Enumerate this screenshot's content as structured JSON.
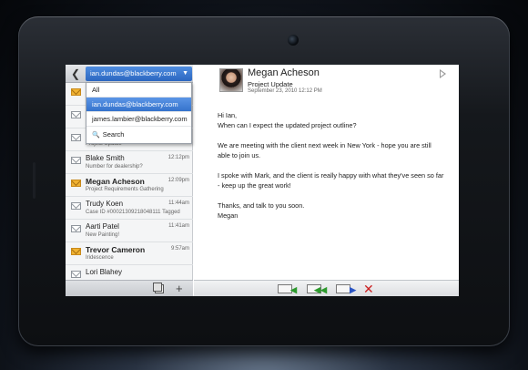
{
  "list": {
    "account": "ian.dundas@blackberry.com",
    "dropdown": {
      "options": [
        "All",
        "ian.dundas@blackberry.com",
        "james.lambier@blackberry.com"
      ],
      "selected_index": 1,
      "search_label": "Search"
    },
    "items": [
      {
        "name": "",
        "sub": "Project Update",
        "time": "",
        "unread": false
      },
      {
        "name": "Blake Smith",
        "sub": "Number for dealership?",
        "time": "12:12pm",
        "unread": false
      },
      {
        "name": "Megan Acheson",
        "sub": "Project Requirements Gathering",
        "time": "12:09pm",
        "unread": true
      },
      {
        "name": "Trudy Koen",
        "sub": "Case ID #00021309218048111 Tagged",
        "time": "11:44am",
        "unread": false
      },
      {
        "name": "Aarti Patel",
        "sub": "New Painting!",
        "time": "11:41am",
        "unread": false
      },
      {
        "name": "Trevor Cameron",
        "sub": "Iridescence",
        "time": "9:57am",
        "unread": true
      },
      {
        "name": "Lori Blahey",
        "sub": "",
        "time": "",
        "unread": false
      }
    ]
  },
  "message": {
    "sender": "Megan Acheson",
    "subject": "Project Update",
    "date": "September 23, 2010 12:12 PM",
    "body": [
      "Hi Ian,",
      "When can I expect the updated project outline?",
      "We are meeting with the client next week in New York - hope you are still able to join us.",
      "I spoke with Mark, and the client is really happy with what they've seen so far - keep up the great work!",
      "Thanks, and talk to you soon.",
      "Megan"
    ]
  },
  "colors": {
    "accent": "#3573cc",
    "unread_envelope": "#f0b232",
    "delete": "#cc2222"
  }
}
